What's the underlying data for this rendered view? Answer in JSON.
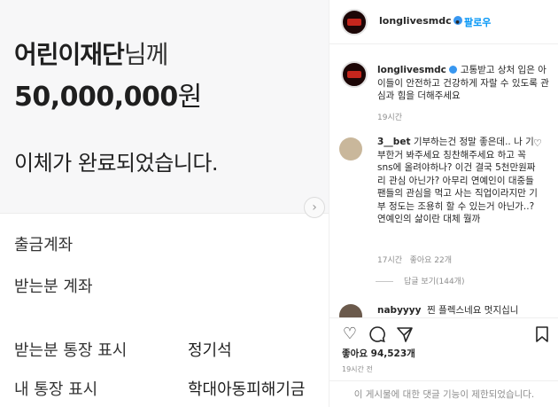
{
  "transfer": {
    "recipient_name": "어린이재단",
    "recipient_suffix": "님께",
    "amount_number": "50,000,000",
    "amount_unit": "원",
    "status": "이체가 완료되었습니다.",
    "rows": [
      {
        "label": "출금계좌",
        "value": ""
      },
      {
        "label": "받는분 계좌",
        "value": ""
      },
      {
        "label": "받는분 통장 표시",
        "value": "정기석"
      },
      {
        "label": "내 통장 표시",
        "value": "학대아동피해기금"
      }
    ]
  },
  "post": {
    "header": {
      "username": "longlivesmdc",
      "follow_label": "팔로우",
      "separator": "•"
    },
    "caption": {
      "username": "longlivesmdc",
      "text": "고통받고 상처 입은 아이들이 안전하고 건강하게 자랄 수 있도록 관심과 힘을 더해주세요",
      "time": "19시간"
    },
    "comment": {
      "username": "3__bet",
      "text": "기부하는건 정말 좋은데.. 나 기부한거 봐주세요 칭찬해주세요 하고 꼭 sns에 올려야하나? 이건 결국 5천만원짜리 관심 아닌가? 아무리 연예인이 대중들 팬들의 관심을 먹고 사는 직업이라지만 기부 정도는 조용히 할 수 있는거 아닌가..? 연예인의 삶이란 대체 뭘까",
      "time": "17시간",
      "likes": "좋아요 22개",
      "replies": "답글 보기(144개)"
    },
    "partial_comment": {
      "username": "nabyyyy",
      "text": "찐 플렉스네요 멋지십니"
    },
    "likes": "좋아요 94,523개",
    "time": "19시간 전",
    "comments_disabled": "이 게시물에 대한 댓글 기능이 제한되었습니다."
  },
  "icons": {
    "next": "chevron-right-icon",
    "heart": "heart-icon",
    "comment": "comment-icon",
    "share": "share-icon",
    "save": "bookmark-icon",
    "verified": "verified-badge-icon"
  },
  "colors": {
    "link": "#0095f6",
    "verified": "#3897f0",
    "muted": "#8e8e8e"
  }
}
